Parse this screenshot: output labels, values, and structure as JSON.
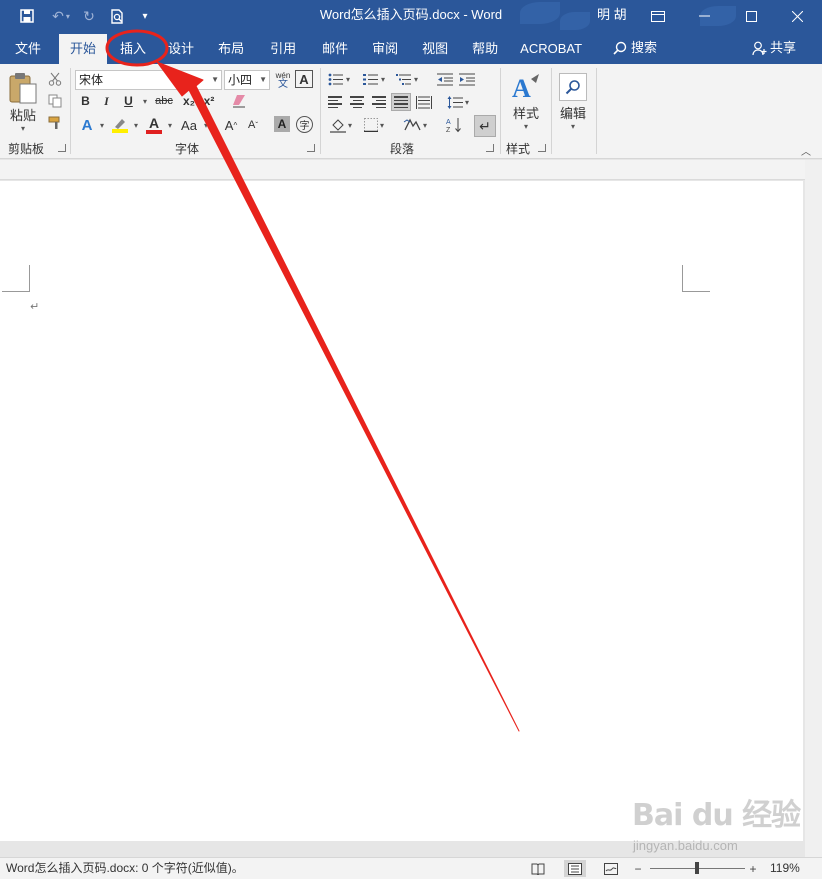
{
  "titlebar": {
    "doc_title": "Word怎么插入页码.docx  -  Word",
    "user": "明 胡",
    "qat": {
      "save_icon": "save-icon",
      "undo_icon": "undo-icon",
      "redo_icon": "redo-icon",
      "print_preview_icon": "print-preview-icon",
      "customize_icon": "customize-qat-icon"
    }
  },
  "tabs": [
    {
      "label": "文件",
      "active": false
    },
    {
      "label": "开始",
      "active": true
    },
    {
      "label": "插入",
      "active": false
    },
    {
      "label": "设计",
      "active": false
    },
    {
      "label": "布局",
      "active": false
    },
    {
      "label": "引用",
      "active": false
    },
    {
      "label": "邮件",
      "active": false
    },
    {
      "label": "审阅",
      "active": false
    },
    {
      "label": "视图",
      "active": false
    },
    {
      "label": "帮助",
      "active": false
    },
    {
      "label": "ACROBAT",
      "active": false
    }
  ],
  "search_label": "搜索",
  "share_label": "共享",
  "ribbon": {
    "clipboard": {
      "paste_label": "粘贴",
      "group_label": "剪贴板"
    },
    "font": {
      "font_name": "宋体",
      "font_size": "小四",
      "group_label": "字体",
      "bold": "B",
      "italic": "I",
      "underline": "U",
      "strike": "abc",
      "subscript": "x₂",
      "superscript": "x²",
      "grow": "A",
      "shrink": "A",
      "change_case": "Aa",
      "char_shading": "A",
      "phonetic": "wén",
      "char_border": "A",
      "enclosed": "字",
      "text_effect": "A",
      "font_color": "A"
    },
    "paragraph": {
      "group_label": "段落"
    },
    "styles": {
      "styles_label": "样式",
      "group_label": "样式"
    },
    "editing": {
      "editing_label": "编辑"
    }
  },
  "document": {
    "paragraph_mark": "↵"
  },
  "statusbar": {
    "text": "Word怎么插入页码.docx: 0 个字符(近似值)。",
    "zoom": "119%",
    "zoom_level": 0.49
  },
  "watermark": {
    "brand": "Bai du 经验",
    "url": "jingyan.baidu.com"
  },
  "annotation": {
    "color": "#e8231c",
    "highlight_target": "插入"
  }
}
